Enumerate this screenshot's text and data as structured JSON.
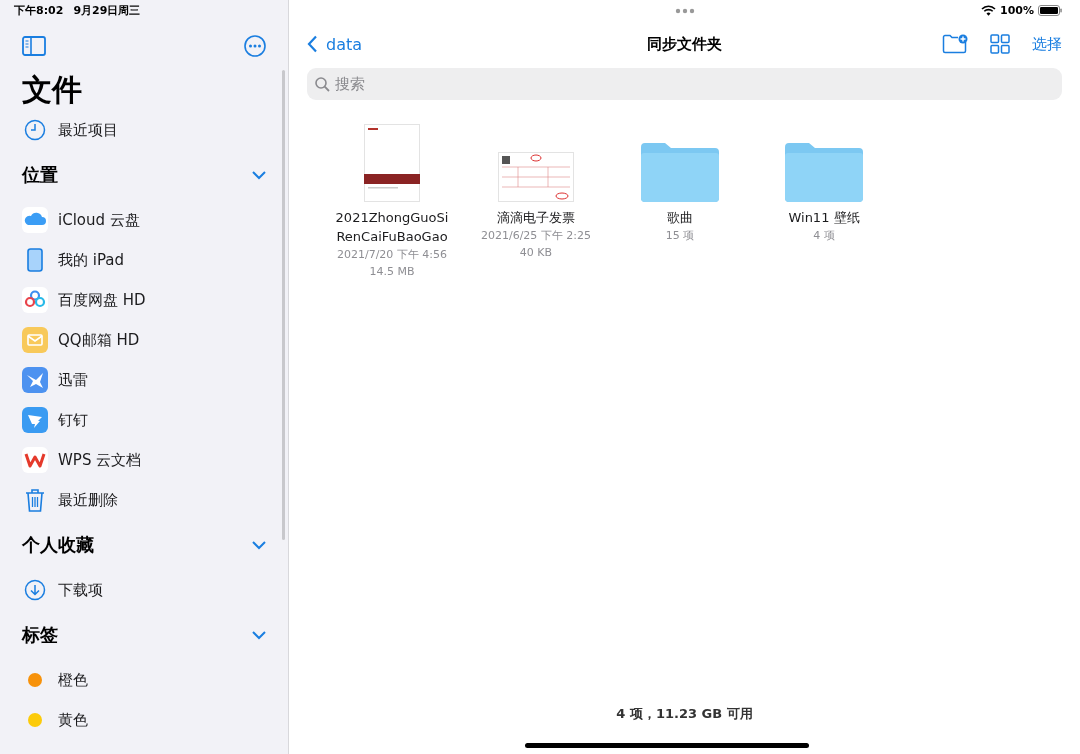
{
  "status_bar": {
    "time": "下午8:02",
    "date": "9月29日周三",
    "battery": "100%"
  },
  "sidebar": {
    "title": "文件",
    "recent": {
      "label": "最近项目"
    },
    "sections": [
      {
        "title": "位置",
        "expanded": true,
        "items": [
          {
            "label": "iCloud 云盘",
            "kind": "cloud"
          },
          {
            "label": "我的 iPad",
            "kind": "ipad"
          },
          {
            "label": "百度网盘 HD",
            "kind": "baidu"
          },
          {
            "label": "QQ邮箱 HD",
            "kind": "mail"
          },
          {
            "label": "迅雷",
            "kind": "bird"
          },
          {
            "label": "钉钉",
            "kind": "ding"
          },
          {
            "label": "WPS 云文档",
            "kind": "wps"
          },
          {
            "label": "最近删除",
            "kind": "trash"
          }
        ]
      },
      {
        "title": "个人收藏",
        "expanded": true,
        "items": [
          {
            "label": "下载项",
            "kind": "download"
          }
        ]
      },
      {
        "title": "标签",
        "expanded": true,
        "items": [
          {
            "label": "橙色",
            "kind": "tag",
            "color": "#f7920a"
          },
          {
            "label": "黄色",
            "kind": "tag",
            "color": "#fccb0a"
          }
        ]
      }
    ]
  },
  "nav": {
    "back": "data",
    "title": "同步文件夹",
    "select": "选择"
  },
  "search": {
    "placeholder": "搜索"
  },
  "files": [
    {
      "kind": "document",
      "name": "2021ZhongGuoSi RenCaiFuBaoGao",
      "meta": [
        "2021/7/20 下午 4:56",
        "14.5 MB"
      ]
    },
    {
      "kind": "invoice",
      "name": "滴滴电子发票",
      "meta": [
        "2021/6/25 下午 2:25",
        "40 KB"
      ]
    },
    {
      "kind": "folder",
      "name": "歌曲",
      "meta": [
        "15 项"
      ]
    },
    {
      "kind": "folder",
      "name": "Win11 壁纸",
      "meta": [
        "4 项"
      ]
    }
  ],
  "footer": "4 项，11.23 GB 可用"
}
